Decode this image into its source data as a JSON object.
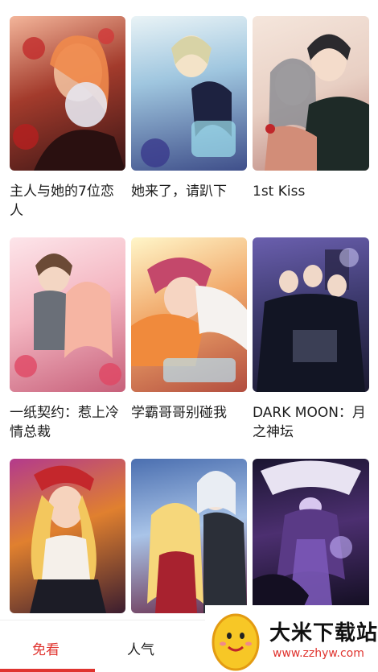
{
  "comics": [
    {
      "title": "主人与她的7位恋人",
      "cover": "cover-c1"
    },
    {
      "title": "她来了，请趴下",
      "cover": "cover-c2"
    },
    {
      "title": "1st Kiss",
      "cover": "cover-c3"
    },
    {
      "title": "一纸契约：惹上冷情总裁",
      "cover": "cover-c4"
    },
    {
      "title": "学霸哥哥别碰我",
      "cover": "cover-c5"
    },
    {
      "title": "DARK MOON：月之神坛",
      "cover": "cover-c6"
    },
    {
      "title": "",
      "cover": "cover-c7"
    },
    {
      "title": "",
      "cover": "cover-c8"
    },
    {
      "title": "",
      "cover": "cover-c9"
    }
  ],
  "tabs": {
    "free": "免看",
    "popular": "人气"
  },
  "watermark": {
    "name": "大米下载站",
    "url": "www.zzhyw.com"
  },
  "colors": {
    "accent": "#e0342f"
  }
}
